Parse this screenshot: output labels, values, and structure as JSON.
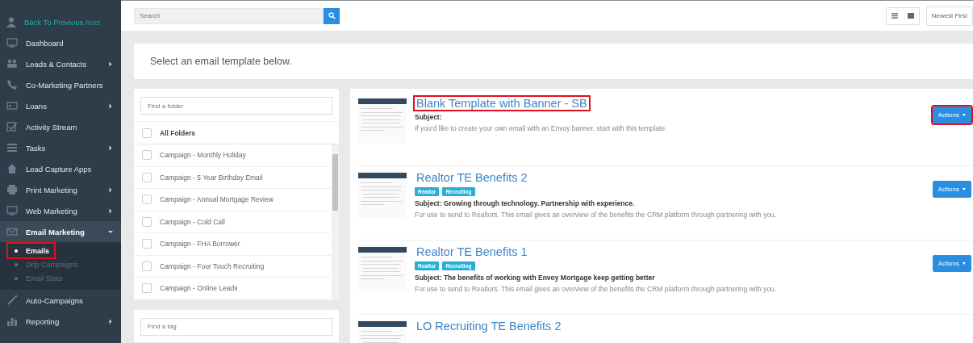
{
  "sidebar": {
    "back_link": "Back To Previous Acct",
    "items": [
      {
        "label": "Dashboard"
      },
      {
        "label": "Leads & Contacts",
        "expanded": false
      },
      {
        "label": "Co-Marketing Partners"
      },
      {
        "label": "Loans",
        "expanded": false
      },
      {
        "label": "Activity Stream"
      },
      {
        "label": "Tasks",
        "expanded": false
      },
      {
        "label": "Lead Capture Apps"
      },
      {
        "label": "Print Marketing",
        "expanded": false
      },
      {
        "label": "Web Marketing",
        "expanded": false
      },
      {
        "label": "Email Marketing",
        "expanded": true,
        "children": [
          {
            "label": "Emails",
            "selected": true,
            "highlighted": true
          },
          {
            "label": "Drip Campaigns",
            "selected": false,
            "highlighted": false
          },
          {
            "label": "Email Stats",
            "selected": false,
            "highlighted": false
          }
        ]
      },
      {
        "label": "Auto-Campaigns"
      },
      {
        "label": "Reporting",
        "expanded": false
      }
    ]
  },
  "toolbar": {
    "search": {
      "placeholder": "Search"
    },
    "sort": "Newest First"
  },
  "instruction": "Select an email template below.",
  "folders": {
    "search": {
      "placeholder": "Find a folder"
    },
    "all": {
      "label": "All Folders",
      "checked": false
    },
    "items": [
      {
        "label": "Campaign - Monthly Holiday",
        "checked": false
      },
      {
        "label": "Campaign - 5 Year Birthday Email",
        "checked": false
      },
      {
        "label": "Campaign - Annual Mortgage Review",
        "checked": false
      },
      {
        "label": "Campaign - Cold Call",
        "checked": false
      },
      {
        "label": "Campaign - FHA Borrower",
        "checked": false
      },
      {
        "label": "Campaign - Four Touch Recruiting",
        "checked": false
      },
      {
        "label": "Campaign - Online Leads",
        "checked": false
      }
    ]
  },
  "tags": {
    "search": {
      "placeholder": "Find a tag"
    }
  },
  "templates": [
    {
      "title": "Blank Template with Banner - SB",
      "title_highlighted": true,
      "subject": "Subject:",
      "description": "If you'd like to create your own email with an Envoy banner, start with this template.",
      "actions": {
        "label": "Actions",
        "highlighted": true
      }
    },
    {
      "title": "Realtor TE Benefits 2",
      "title_highlighted": false,
      "tags": [
        "Realtor",
        "Recruiting"
      ],
      "subject": "Subject: Growing through technology. Partnership with experience.",
      "description": "For use to send to Realtors. This email gives an overview of the benefits the CRM platform through partnering with you.",
      "actions": {
        "label": "Actions",
        "highlighted": false
      }
    },
    {
      "title": "Realtor TE Benefits 1",
      "title_highlighted": false,
      "tags": [
        "Realtor",
        "Recruiting"
      ],
      "subject": "Subject: The benefits of working with Envoy Mortgage keep getting better",
      "description": "For use to send to Realtors. This email gives an overview of the benefits the CRM platform through partnering with you.",
      "actions": {
        "label": "Actions",
        "highlighted": false
      }
    },
    {
      "title": "LO Recruiting TE Benefits 2",
      "title_highlighted": false
    }
  ]
}
